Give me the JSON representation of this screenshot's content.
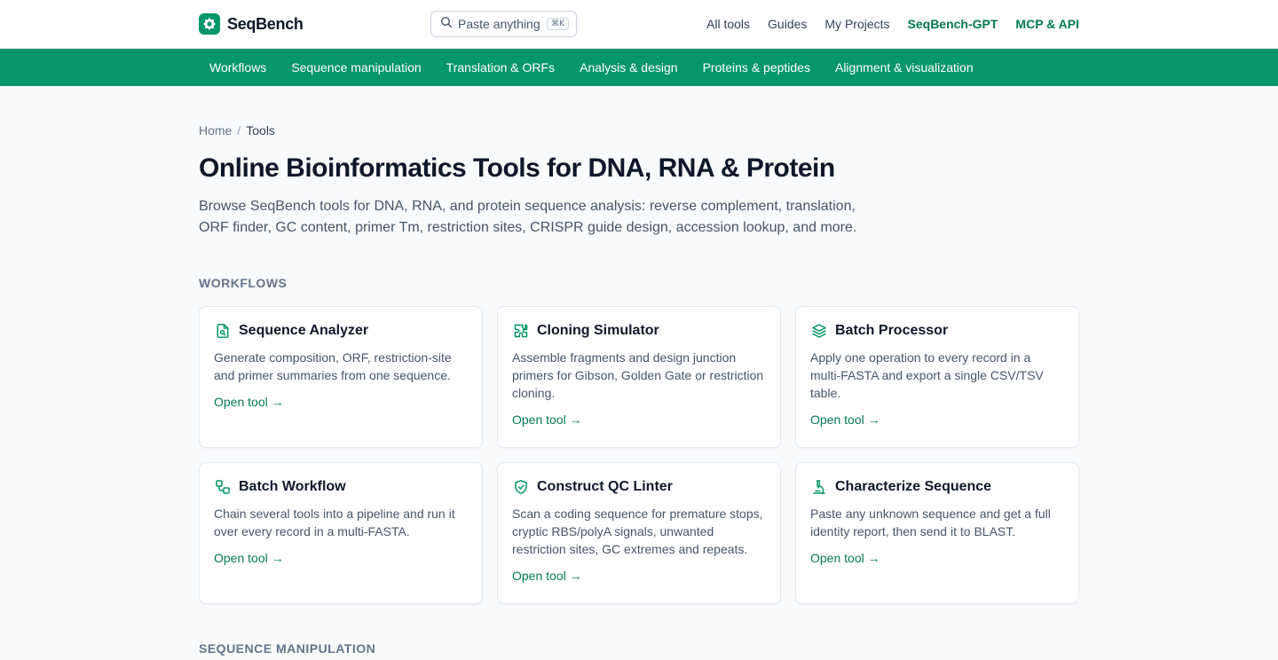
{
  "header": {
    "brand": "SeqBench",
    "search": {
      "placeholder": "Paste anything",
      "shortcut": "⌘K"
    },
    "nav": [
      {
        "label": "All tools"
      },
      {
        "label": "Guides"
      },
      {
        "label": "My Projects"
      },
      {
        "label": "SeqBench-GPT"
      },
      {
        "label": "MCP & API"
      }
    ]
  },
  "categories": [
    {
      "label": "Workflows"
    },
    {
      "label": "Sequence manipulation"
    },
    {
      "label": "Translation & ORFs"
    },
    {
      "label": "Analysis & design"
    },
    {
      "label": "Proteins & peptides"
    },
    {
      "label": "Alignment & visualization"
    }
  ],
  "breadcrumb": {
    "home": "Home",
    "separator": "/",
    "current": "Tools"
  },
  "page": {
    "title": "Online Bioinformatics Tools for DNA, RNA & Protein",
    "intro": "Browse SeqBench tools for DNA, RNA, and protein sequence analysis: reverse complement, translation, ORF finder, GC content, primer Tm, restriction sites, CRISPR guide design, accession lookup, and more."
  },
  "sections": {
    "workflows": {
      "label": "WORKFLOWS",
      "cards": [
        {
          "title": "Sequence Analyzer",
          "icon": "file-search-icon",
          "description": "Generate composition, ORF, restriction-site and primer summaries from one sequence.",
          "link": "Open tool →"
        },
        {
          "title": "Cloning Simulator",
          "icon": "puzzle-icon",
          "description": "Assemble fragments and design junction primers for Gibson, Golden Gate or restriction cloning.",
          "link": "Open tool →"
        },
        {
          "title": "Batch Processor",
          "icon": "layers-icon",
          "description": "Apply one operation to every record in a multi-FASTA and export a single CSV/TSV table.",
          "link": "Open tool →"
        },
        {
          "title": "Batch Workflow",
          "icon": "workflow-icon",
          "description": "Chain several tools into a pipeline and run it over every record in a multi-FASTA.",
          "link": "Open tool →"
        },
        {
          "title": "Construct QC Linter",
          "icon": "shield-check-icon",
          "description": "Scan a coding sequence for premature stops, cryptic RBS/polyA signals, unwanted restriction sites, GC extremes and repeats.",
          "link": "Open tool →"
        },
        {
          "title": "Characterize Sequence",
          "icon": "microscope-icon",
          "description": "Paste any unknown sequence and get a full identity report, then send it to BLAST.",
          "link": "Open tool →"
        }
      ]
    },
    "sequence_manipulation": {
      "label": "SEQUENCE MANIPULATION"
    }
  },
  "colors": {
    "brand": "#059669",
    "accent_text": "#047857",
    "page_bg": "#f8fafc"
  }
}
